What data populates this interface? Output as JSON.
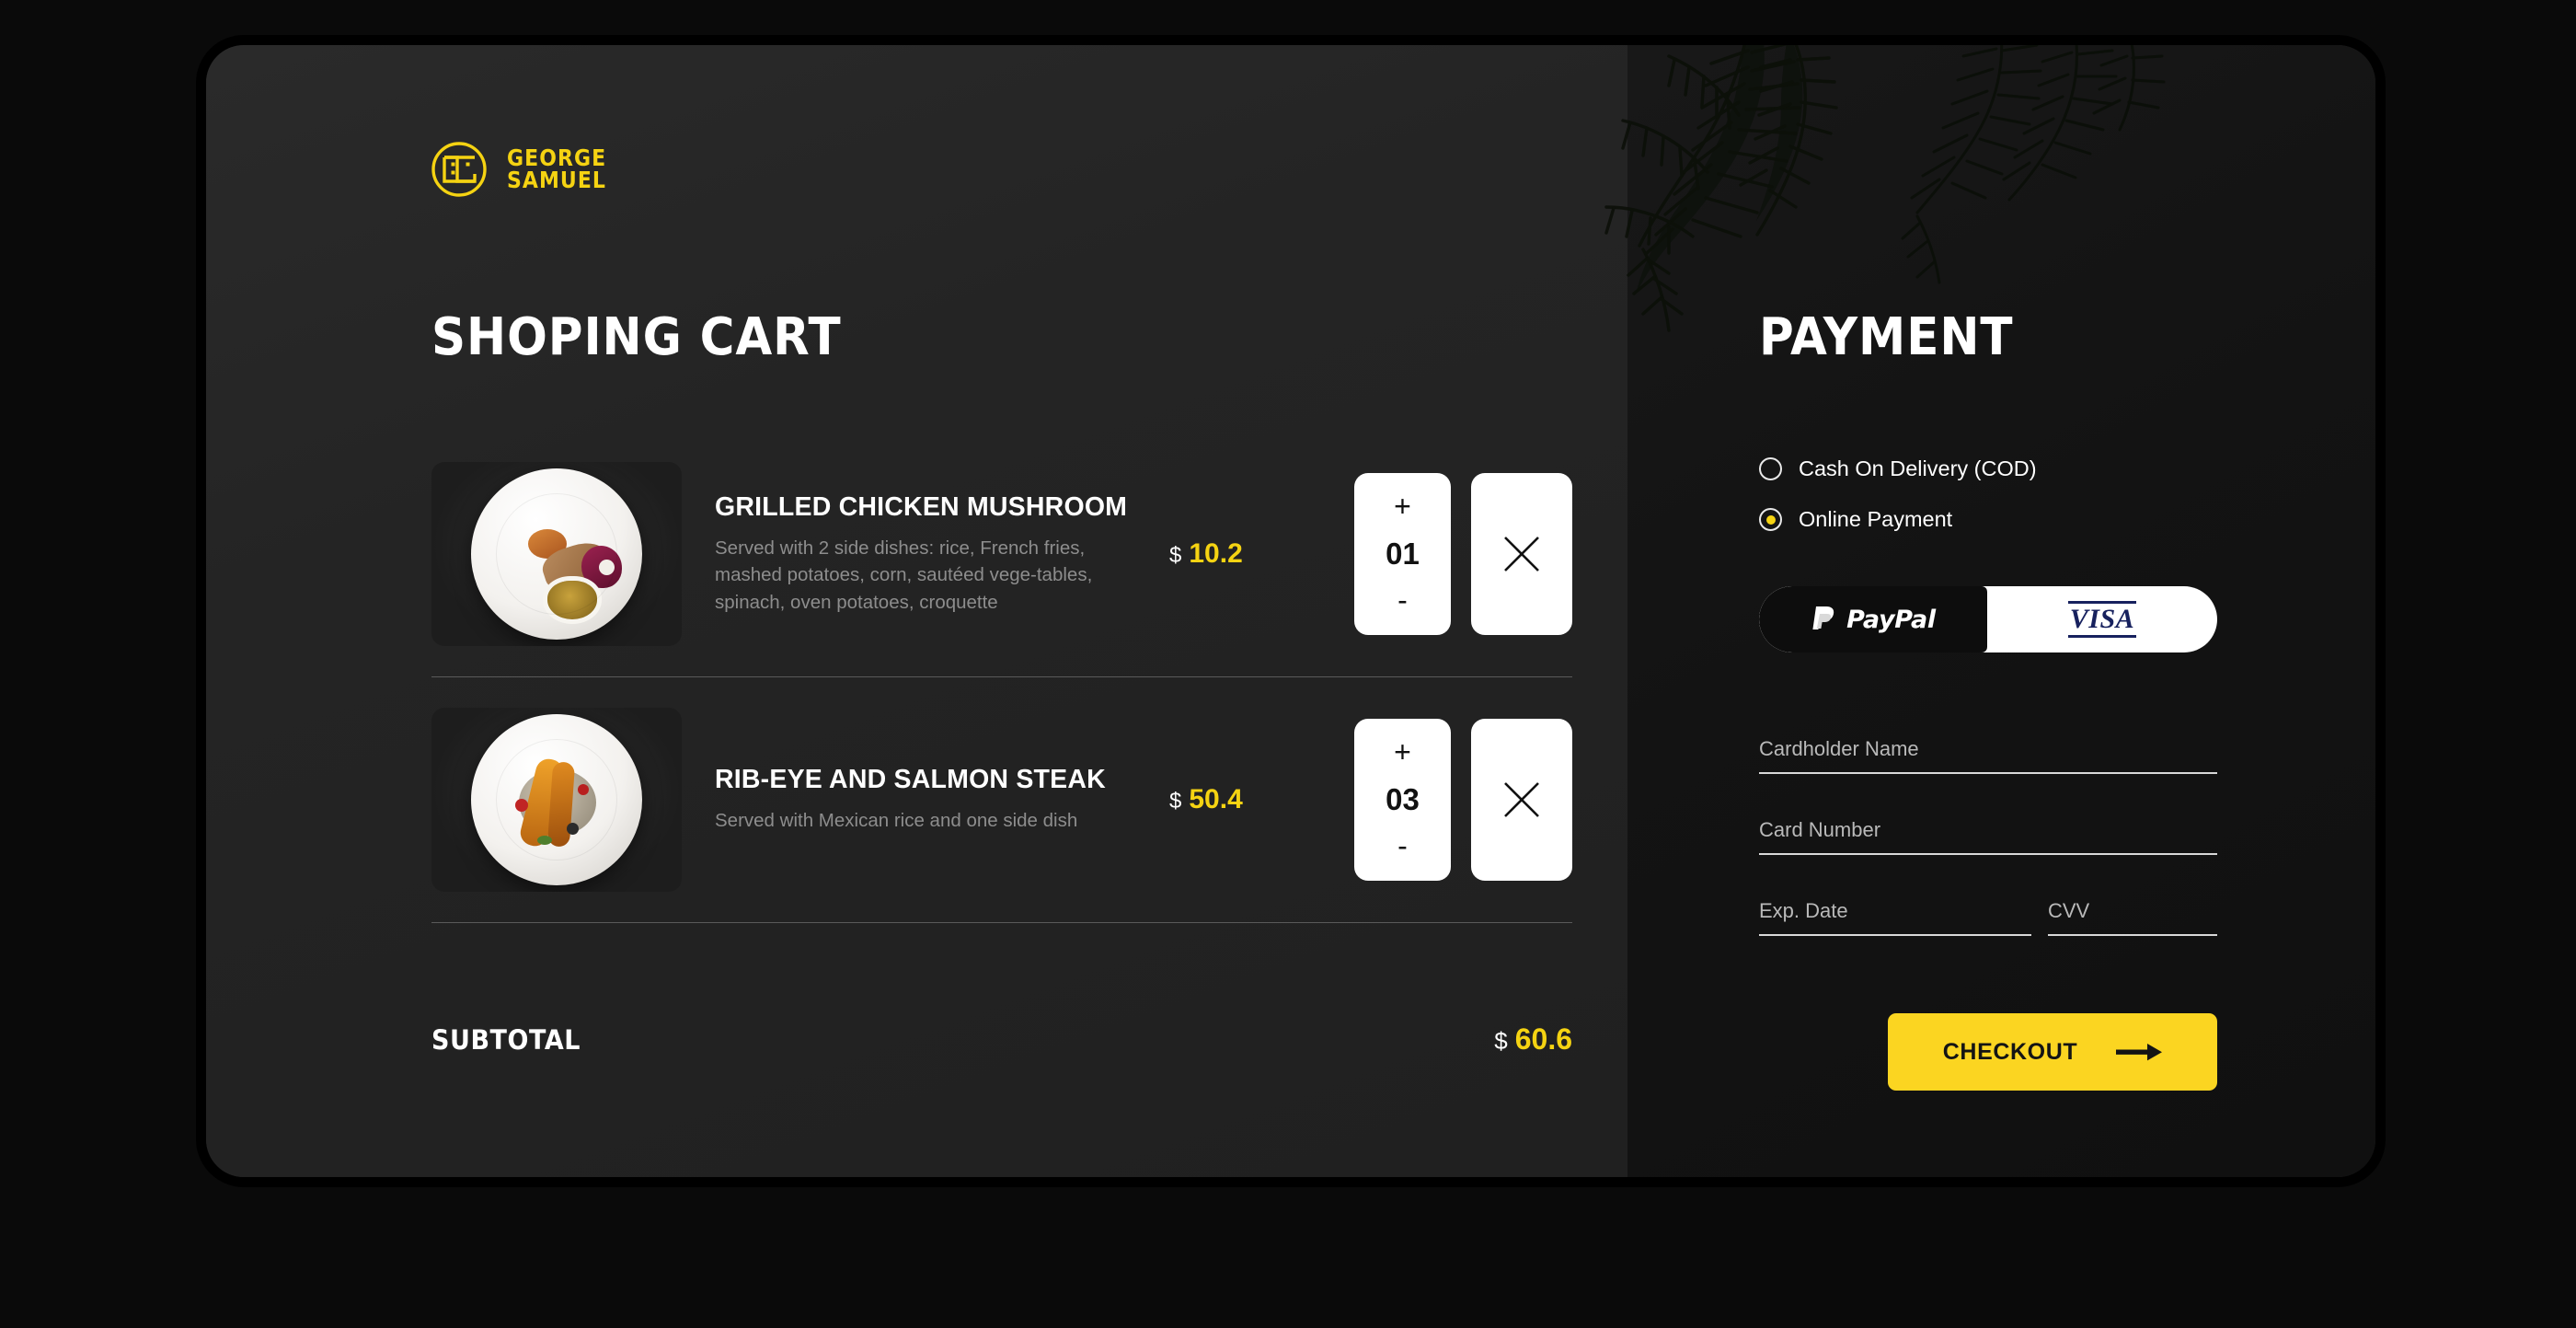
{
  "brand": {
    "line1": "GEORGE",
    "line2": "SAMUEL",
    "logo_icon": "monogram-circle-icon",
    "accent_color": "#f5d312"
  },
  "cart": {
    "title": "SHOPING CART",
    "items": [
      {
        "name": "GRILLED CHICKEN MUSHROOM",
        "description": "Served with 2 side dishes: rice, French fries, mashed potatoes, corn, sautéed vege-tables, spinach, oven potatoes, croquette",
        "currency": "$",
        "price": "10.2",
        "quantity": "01",
        "increase_label": "+",
        "decrease_label": "-",
        "remove_icon": "close-x-icon",
        "image_alt": "grilled-chicken-plate"
      },
      {
        "name": "RIB-EYE AND SALMON STEAK",
        "description": "Served with Mexican rice and one side dish",
        "currency": "$",
        "price": "50.4",
        "quantity": "03",
        "increase_label": "+",
        "decrease_label": "-",
        "remove_icon": "close-x-icon",
        "image_alt": "rib-eye-salmon-plate"
      }
    ],
    "subtotal_label": "SUBTOTAL",
    "subtotal_currency": "$",
    "subtotal_value": "60.6"
  },
  "payment": {
    "title": "PAYMENT",
    "methods": [
      {
        "label": "Cash On Delivery (COD)",
        "selected": false
      },
      {
        "label": "Online Payment",
        "selected": true
      }
    ],
    "providers": {
      "paypal_label": "PayPal",
      "paypal_selected": true,
      "visa_label": "VISA",
      "visa_selected": false
    },
    "fields": [
      {
        "label": "Cardholder Name",
        "value": ""
      },
      {
        "label": "Card Number",
        "value": ""
      },
      {
        "label": "Exp. Date",
        "value": ""
      },
      {
        "label": "CVV",
        "value": ""
      }
    ],
    "checkout_label": "CHECKOUT",
    "checkout_icon": "arrow-right-icon",
    "checkout_color": "#fbd521"
  }
}
